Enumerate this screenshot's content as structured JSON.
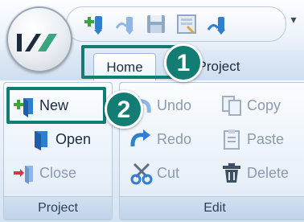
{
  "quick_access": {
    "icons": [
      "add-icon",
      "undo-icon",
      "save-icon",
      "preview-icon",
      "redo-icon"
    ],
    "dropdown_icon": "▾"
  },
  "tabs": [
    {
      "label": "Home",
      "selected": true
    },
    {
      "label": "Project",
      "selected": false
    }
  ],
  "groups": {
    "project": {
      "label": "Project",
      "buttons": [
        {
          "label": "New",
          "icon": "new-icon",
          "enabled": true
        },
        {
          "label": "Open",
          "icon": "open-icon",
          "enabled": true
        },
        {
          "label": "Close",
          "icon": "close-icon",
          "enabled": false
        }
      ]
    },
    "edit": {
      "label": "Edit",
      "buttons": [
        {
          "label": "Undo",
          "icon": "undo-icon",
          "enabled": false
        },
        {
          "label": "Redo",
          "icon": "redo-icon",
          "enabled": false
        },
        {
          "label": "Cut",
          "icon": "cut-icon",
          "enabled": true
        },
        {
          "label": "Copy",
          "icon": "copy-icon",
          "enabled": false
        },
        {
          "label": "Paste",
          "icon": "paste-icon",
          "enabled": false
        },
        {
          "label": "Delete",
          "icon": "delete-icon",
          "enabled": true
        }
      ]
    }
  },
  "callouts": [
    {
      "number": "1"
    },
    {
      "number": "2"
    }
  ],
  "colors": {
    "callout": "#137d74",
    "accent_blue": "#2f7fd1",
    "accent_green": "#3aa53a",
    "accent_red": "#d23b3b"
  }
}
